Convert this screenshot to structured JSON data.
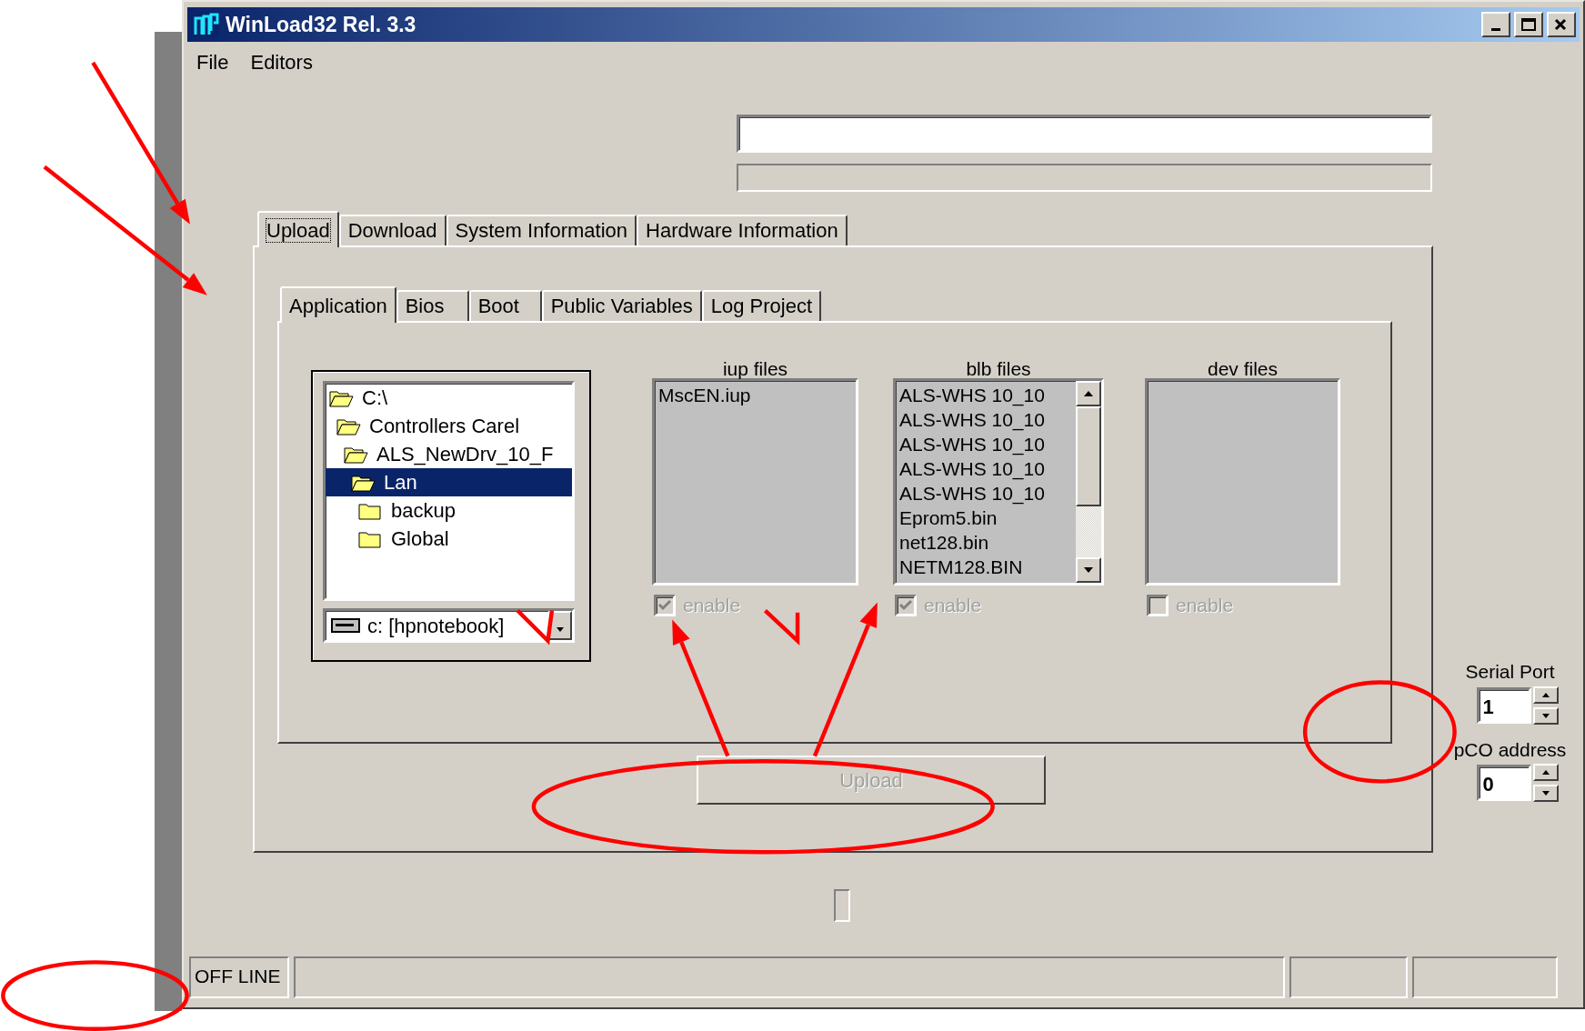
{
  "window": {
    "title": "WinLoad32 Rel. 3.3"
  },
  "menu": [
    "File",
    "Editors"
  ],
  "outer_tabs": [
    {
      "label": "Upload",
      "selected": true
    },
    {
      "label": "Download",
      "selected": false
    },
    {
      "label": "System Information",
      "selected": false
    },
    {
      "label": "Hardware Information",
      "selected": false
    }
  ],
  "inner_tabs": [
    {
      "label": "Application",
      "selected": true
    },
    {
      "label": "Bios",
      "selected": false
    },
    {
      "label": "Boot",
      "selected": false
    },
    {
      "label": "Public Variables",
      "selected": false
    },
    {
      "label": "Log Project",
      "selected": false
    }
  ],
  "folder_tree": [
    {
      "label": "C:\\",
      "expanded": true,
      "selected": false,
      "children": [
        {
          "label": "Controllers Carel",
          "expanded": true,
          "selected": false,
          "children": [
            {
              "label": "ALS_NewDrv_10_F",
              "expanded": true,
              "selected": false,
              "children": [
                {
                  "label": "Lan",
                  "expanded": true,
                  "selected": true,
                  "children": [
                    {
                      "label": "backup",
                      "expanded": false,
                      "selected": false
                    },
                    {
                      "label": "Global",
                      "expanded": false,
                      "selected": false
                    }
                  ]
                }
              ]
            }
          ]
        }
      ]
    }
  ],
  "drive": {
    "value": "c: [hpnotebook]"
  },
  "file_lists": [
    {
      "title": "iup files",
      "items": [
        "MscEN.iup"
      ],
      "enable": {
        "label": "enable",
        "checked": true,
        "disabled": true
      }
    },
    {
      "title": "blb files",
      "items": [
        "ALS-WHS 10_10",
        "ALS-WHS 10_10",
        "ALS-WHS 10_10",
        "ALS-WHS 10_10",
        "ALS-WHS 10_10",
        "Eprom5.bin",
        "net128.bin",
        "NETM128.BIN"
      ],
      "enable": {
        "label": "enable",
        "checked": true,
        "disabled": true
      }
    },
    {
      "title": "dev files",
      "enable": {
        "label": "enable",
        "checked": false,
        "disabled": true
      }
    }
  ],
  "upload_button": {
    "label": "Upload",
    "disabled": true
  },
  "serial_port": {
    "label": "Serial Port",
    "value": "1"
  },
  "pco_address": {
    "label": "pCO address",
    "value": "0"
  },
  "status_bar": {
    "text": "OFF LINE"
  }
}
